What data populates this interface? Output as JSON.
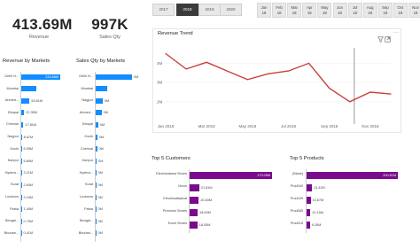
{
  "kpis": [
    {
      "value": "413.69M",
      "label": "Revenue"
    },
    {
      "value": "997K",
      "label": "Sales Qty"
    }
  ],
  "year_slicer": {
    "years": [
      "2017",
      "2018",
      "2019",
      "2020"
    ],
    "selected": "2018"
  },
  "month_slicer": [
    [
      "Jan",
      "18"
    ],
    [
      "Feb",
      "18"
    ],
    [
      "Mar",
      "18"
    ],
    [
      "Apr",
      "18"
    ],
    [
      "May",
      "18"
    ],
    [
      "Jun",
      "18"
    ],
    [
      "Jul",
      "18"
    ],
    [
      "Aug",
      "18"
    ],
    [
      "Sep",
      "18"
    ],
    [
      "Oct",
      "18"
    ],
    [
      "Nov",
      "18"
    ]
  ],
  "colors": {
    "blue": "#118dff",
    "purple": "#7b0a8e",
    "red": "#c8423b",
    "dark": "#3b3b3b"
  },
  "icons": {
    "filter": "filter-icon",
    "focus": "focus-mode-icon",
    "more": "more-options-icon"
  },
  "chart_data": [
    {
      "type": "bar",
      "title": "Revenue by Markets",
      "orientation": "horizontal",
      "color": "#118dff",
      "categories": [
        "Delhi N...",
        "Mumbai",
        "Ahmed...",
        "Bhopal",
        "Chennai",
        "Nagpur",
        "Kochi",
        "Kanpur",
        "Hydera...",
        "Surat",
        "Lucknow",
        "Patna",
        "Bengal...",
        "Bhuban..."
      ],
      "value_labels": [
        "233.88M",
        "",
        "53.81M",
        "22.35M",
        "17.81M",
        "8.67M",
        "6.95M",
        "5.89M",
        "3.21M",
        "2.84M",
        "2.19M",
        "1.45M",
        "0.79M",
        "0.41M"
      ],
      "values": [
        233.88,
        95,
        53.81,
        22.35,
        17.81,
        8.67,
        6.95,
        5.89,
        3.21,
        2.84,
        2.19,
        1.45,
        0.79,
        0.41
      ]
    },
    {
      "type": "bar",
      "title": "Sales Qty by Markets",
      "orientation": "horizontal",
      "color": "#118dff",
      "categories": [
        "Delhi N...",
        "Mumbai",
        "Nagpur",
        "Ahmed...",
        "Bhopal",
        "Kochi",
        "Chennai",
        "Kanpur",
        "Hydera...",
        "Surat",
        "Lucknow",
        "Patna",
        "Bengal...",
        "Bhuban..."
      ],
      "value_labels": [
        "0M",
        "",
        "0M",
        "0M",
        "0M",
        "0M",
        "0M",
        "0M",
        "0M",
        "0M",
        "0M",
        "0M",
        "0M",
        "0M"
      ],
      "values": [
        0.47,
        0.16,
        0.1,
        0.085,
        0.043,
        0.031,
        0.028,
        0.024,
        0.018,
        0.015,
        0.012,
        0.009,
        0.005,
        0.003
      ]
    },
    {
      "type": "line",
      "title": "Revenue Trend",
      "color": "#c8423b",
      "x": [
        "Jan 2018",
        "Feb 2018",
        "Mar 2018",
        "Apr 2018",
        "May 2018",
        "Jun 2018",
        "Jul 2018",
        "Aug 2018",
        "Sep 2018",
        "Oct 2018",
        "Nov 2018",
        "Dec 2018"
      ],
      "x_tick_labels": [
        "Jan 2018",
        "Mar 2018",
        "May 2018",
        "Jul 2018",
        "Sep 2018",
        "Nov 2018"
      ],
      "y": [
        45,
        37,
        40.5,
        36,
        31.5,
        34.5,
        36,
        40,
        27,
        20,
        25,
        24
      ],
      "y_tick_labels": [
        "4M",
        "3M",
        "2M"
      ],
      "ylim": [
        19,
        48
      ]
    },
    {
      "type": "bar",
      "title": "Top 5 Customers",
      "orientation": "horizontal",
      "color": "#7b0a8e",
      "categories": [
        "Electricalsara Stores",
        "Nixon",
        "Electricalslytical",
        "Premium Stores",
        "Excel Stores"
      ],
      "value_labels": [
        "173.05M",
        "21.81M",
        "20.83M",
        "18.69M",
        "18.05M"
      ],
      "values": [
        173.05,
        21.81,
        20.83,
        18.69,
        18.05
      ]
    },
    {
      "type": "bar",
      "title": "Top 5 Products",
      "orientation": "horizontal",
      "color": "#7b0a8e",
      "categories": [
        "(Blank)",
        "Prod040",
        "Prod159",
        "Prod065",
        "Prod018"
      ],
      "value_labels": [
        "200.61M",
        "13.42M",
        "10.87M",
        "10.15M",
        "9.26M"
      ],
      "values": [
        200.61,
        13.42,
        10.87,
        10.15,
        9.26
      ]
    }
  ]
}
